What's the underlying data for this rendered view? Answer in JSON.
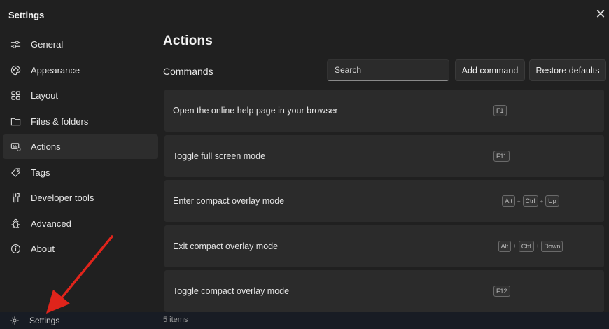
{
  "window": {
    "title": "Settings"
  },
  "sidebar": {
    "items": [
      {
        "label": "General",
        "icon": "sliders-icon"
      },
      {
        "label": "Appearance",
        "icon": "palette-icon"
      },
      {
        "label": "Layout",
        "icon": "grid-icon"
      },
      {
        "label": "Files & folders",
        "icon": "folder-icon"
      },
      {
        "label": "Actions",
        "icon": "keyboard-icon",
        "active": true
      },
      {
        "label": "Tags",
        "icon": "tag-icon"
      },
      {
        "label": "Developer tools",
        "icon": "wrench-icon"
      },
      {
        "label": "Advanced",
        "icon": "bug-icon"
      },
      {
        "label": "About",
        "icon": "info-icon"
      }
    ]
  },
  "main": {
    "title": "Actions",
    "section": "Commands",
    "search_placeholder": "Search",
    "add_command": "Add command",
    "restore_defaults": "Restore defaults",
    "commands": [
      {
        "label": "Open the online help page in your browser",
        "keys": [
          "F1"
        ]
      },
      {
        "label": "Toggle full screen mode",
        "keys": [
          "F11"
        ]
      },
      {
        "label": "Enter compact overlay mode",
        "keys": [
          "Alt",
          "Ctrl",
          "Up"
        ]
      },
      {
        "label": "Exit compact overlay mode",
        "keys": [
          "Alt",
          "Ctrl",
          "Down"
        ]
      },
      {
        "label": "Toggle compact overlay mode",
        "keys": [
          "F12"
        ]
      }
    ]
  },
  "status": {
    "settings_label": "Settings",
    "items_count": "5 items"
  },
  "colors": {
    "background": "#202020",
    "active_item": "#2d2d2d",
    "row": "#2b2b2b",
    "annotation_arrow": "#e0241b"
  }
}
